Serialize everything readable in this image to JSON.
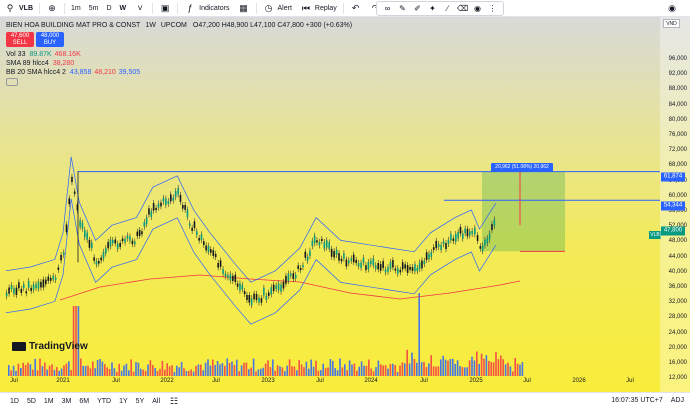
{
  "toolbar": {
    "symbol": "VLB",
    "intervals": [
      "1m",
      "5m",
      "D",
      "W"
    ],
    "indicators_label": "Indicators",
    "alert_label": "Alert",
    "replay_label": "Replay"
  },
  "legend": {
    "title": "BIEN HOA BUILDING MAT PRO & CONST",
    "interval": "1W",
    "exchange": "UPCOM",
    "ohlc": "O47,200  H48,900  L47,100  C47,800  +300 (+0.63%)",
    "sell_price": "47,600",
    "sell_label": "SELL",
    "buy_price": "48,000",
    "buy_label": "BUY",
    "vol_name": "Vol 33",
    "vol_v1": "89.87K",
    "vol_v2": "468.16K",
    "sma_name": "SMA 89 hlcc4",
    "sma_value": "38,280",
    "bb_name": "BB 20 SMA hlcc4 2",
    "bb_v1": "43,858",
    "bb_v2": "48,210",
    "bb_v3": "39,505"
  },
  "price_axis": {
    "currency": "VND",
    "labels": [
      "96,000",
      "92,000",
      "88,000",
      "84,000",
      "80,000",
      "76,000",
      "72,000",
      "68,000",
      "64,000",
      "60,000",
      "56,000",
      "52,000",
      "48,000",
      "44,000",
      "40,000",
      "36,000",
      "32,000",
      "28,000",
      "24,000",
      "20,000",
      "16,000",
      "12,000"
    ],
    "tag_high": "61,874",
    "tag_mid": "54,344",
    "tag_last": "47,800",
    "tag_symbol": "VLB"
  },
  "measure": {
    "label": "20,962 (51.08%) 20,962"
  },
  "time_axis": {
    "labels": [
      "Jul",
      "2021",
      "Jul",
      "2022",
      "Jul",
      "2023",
      "Jul",
      "2024",
      "Jul",
      "2025",
      "Jul",
      "2026",
      "Jul"
    ]
  },
  "logo": {
    "text": "TradingView"
  },
  "bottombar": {
    "ranges": [
      "1D",
      "5D",
      "1M",
      "3M",
      "6M",
      "YTD",
      "1Y",
      "5Y",
      "All"
    ],
    "clock": "16:07:35 UTC+7",
    "adj": "ADJ"
  },
  "chart_data": {
    "type": "candlestick",
    "ylim": [
      10000,
      100000
    ],
    "price_series": [
      {
        "t": "2020-06",
        "close": 30000
      },
      {
        "t": "2020-09",
        "close": 31000
      },
      {
        "t": "2020-12",
        "close": 33000
      },
      {
        "t": "2021-01",
        "close": 40000
      },
      {
        "t": "2021-02",
        "close": 60000
      },
      {
        "t": "2021-03",
        "close": 48000
      },
      {
        "t": "2021-05",
        "close": 38000
      },
      {
        "t": "2021-07",
        "close": 42000
      },
      {
        "t": "2021-10",
        "close": 44000
      },
      {
        "t": "2021-12",
        "close": 52000
      },
      {
        "t": "2022-03",
        "close": 55000
      },
      {
        "t": "2022-05",
        "close": 46000
      },
      {
        "t": "2022-07",
        "close": 40000
      },
      {
        "t": "2022-10",
        "close": 32000
      },
      {
        "t": "2022-12",
        "close": 27000
      },
      {
        "t": "2023-03",
        "close": 30000
      },
      {
        "t": "2023-06",
        "close": 36000
      },
      {
        "t": "2023-08",
        "close": 44000
      },
      {
        "t": "2023-11",
        "close": 38000
      },
      {
        "t": "2024-02",
        "close": 37000
      },
      {
        "t": "2024-05",
        "close": 36000
      },
      {
        "t": "2024-08",
        "close": 35000
      },
      {
        "t": "2024-10",
        "close": 40000
      },
      {
        "t": "2025-01",
        "close": 44000
      },
      {
        "t": "2025-03",
        "close": 46000
      },
      {
        "t": "2025-04",
        "close": 41000
      },
      {
        "t": "2025-06",
        "close": 47800
      }
    ],
    "sma89_level": 38280,
    "bb": {
      "basis": 43858,
      "upper": 48210,
      "lower": 39505
    },
    "horizontal_lines": [
      61874,
      54344
    ],
    "measure_range": [
      40912,
      61874
    ]
  }
}
